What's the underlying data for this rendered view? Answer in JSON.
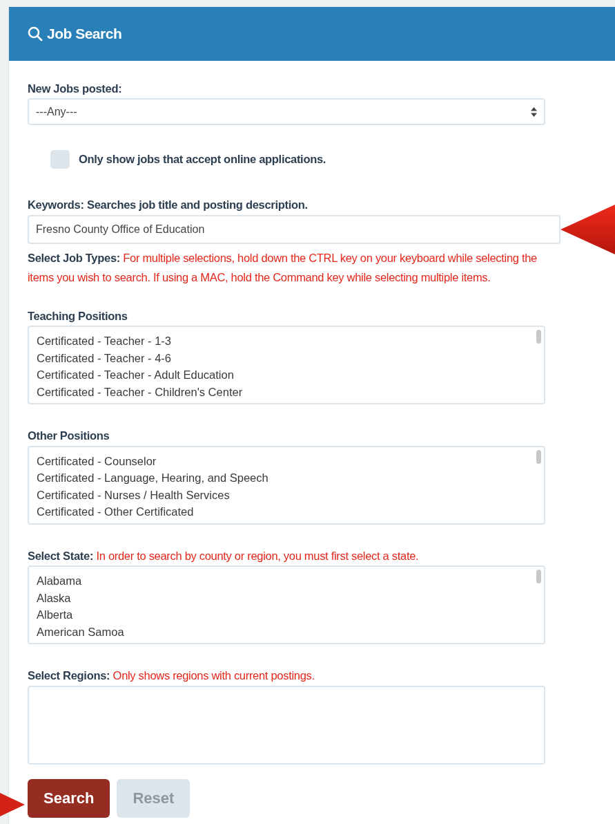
{
  "panel": {
    "title": "Job Search"
  },
  "fields": [
    {
      "kind": "select",
      "label": "New Jobs posted:",
      "value": "---Any---"
    },
    {
      "kind": "checkbox",
      "label": "Only show jobs that accept online applications.",
      "checked": false
    },
    {
      "kind": "text",
      "label": "Keywords: Searches job title and posting description.",
      "value": "Fresno County Office of Education"
    },
    {
      "kind": "note",
      "label": "Select Job Types:",
      "note": "For multiple selections, hold down the CTRL key on your keyboard while selecting the items you wish to search. If using a MAC, hold the Command key while selecting multiple items."
    },
    {
      "kind": "list",
      "label": "Teaching Positions",
      "options": [
        "Certificated - Teacher - 1-3",
        "Certificated - Teacher - 4-6",
        "Certificated - Teacher - Adult Education",
        "Certificated - Teacher - Children's Center"
      ]
    },
    {
      "kind": "list",
      "label": "Other Positions",
      "options": [
        "Certificated - Counselor",
        "Certificated - Language, Hearing, and Speech",
        "Certificated - Nurses / Health Services",
        "Certificated - Other Certificated"
      ]
    },
    {
      "kind": "list",
      "label": "Select State:",
      "note": "In order to search by county or region, you must first select a state.",
      "options": [
        "Alabama",
        "Alaska",
        "Alberta",
        "American Samoa"
      ]
    },
    {
      "kind": "list",
      "label": "Select Regions:",
      "note": "Only shows regions with current postings."
    }
  ],
  "buttons": [
    {
      "label": "Search",
      "kind": "primary"
    },
    {
      "label": "Reset",
      "kind": "secondary"
    }
  ]
}
